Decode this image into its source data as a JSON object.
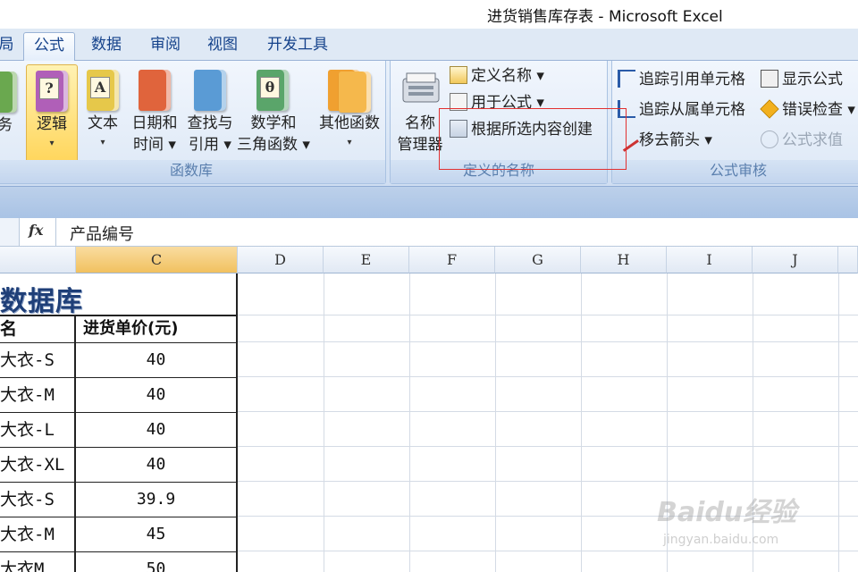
{
  "window": {
    "title": "进货销售库存表 - Microsoft Excel"
  },
  "tabs": [
    {
      "label": "局",
      "active": false
    },
    {
      "label": "公式",
      "active": true
    },
    {
      "label": "数据",
      "active": false
    },
    {
      "label": "审阅",
      "active": false
    },
    {
      "label": "视图",
      "active": false
    },
    {
      "label": "开发工具",
      "active": false
    }
  ],
  "ribbon": {
    "function_library": {
      "label": "函数库",
      "buttons": [
        {
          "line1": "务",
          "line2": ""
        },
        {
          "line1": "逻辑",
          "line2": "▾",
          "glyph": "?"
        },
        {
          "line1": "文本",
          "line2": "▾",
          "glyph": "A"
        },
        {
          "line1": "日期和",
          "line2": "时间 ▾"
        },
        {
          "line1": "查找与",
          "line2": "引用 ▾"
        },
        {
          "line1": "数学和",
          "line2": "三角函数 ▾",
          "glyph": "θ"
        },
        {
          "line1": "其他函数",
          "line2": "▾"
        }
      ]
    },
    "defined_names": {
      "label": "定义的名称",
      "name_manager": {
        "line1": "名称",
        "line2": "管理器"
      },
      "define_name": "定义名称 ▾",
      "use_in_formula": "用于公式 ▾",
      "create_from_selection": "根据所选内容创建"
    },
    "formula_auditing": {
      "label": "公式审核",
      "trace_precedents": "追踪引用单元格",
      "trace_dependents": "追踪从属单元格",
      "remove_arrows": "移去箭头 ▾",
      "show_formulas": "显示公式",
      "error_checking": "错误检查 ▾",
      "evaluate_formula": "公式求值"
    }
  },
  "formula_bar": {
    "fx": "fx",
    "content": "产品编号"
  },
  "columns": [
    "C",
    "D",
    "E",
    "F",
    "G",
    "H",
    "I",
    "J"
  ],
  "sheet": {
    "title": "数据库",
    "header": {
      "b": "名",
      "c": "进货单价(元)"
    },
    "rows": [
      {
        "b": "大衣-S",
        "c": "40"
      },
      {
        "b": "大衣-M",
        "c": "40"
      },
      {
        "b": "大衣-L",
        "c": "40"
      },
      {
        "b": "大衣-XL",
        "c": "40"
      },
      {
        "b": "大衣-S",
        "c": "39.9"
      },
      {
        "b": "大衣-M",
        "c": "45"
      },
      {
        "b": "大衣M",
        "c": "50"
      }
    ]
  },
  "watermark": {
    "brand": "Baidu经验",
    "url": "jingyan.baidu.com"
  },
  "colors": {
    "ribbon": "#dfe9f5",
    "accent": "#15428b",
    "highlight": "#ffd65c",
    "red_box": "#e23030"
  }
}
